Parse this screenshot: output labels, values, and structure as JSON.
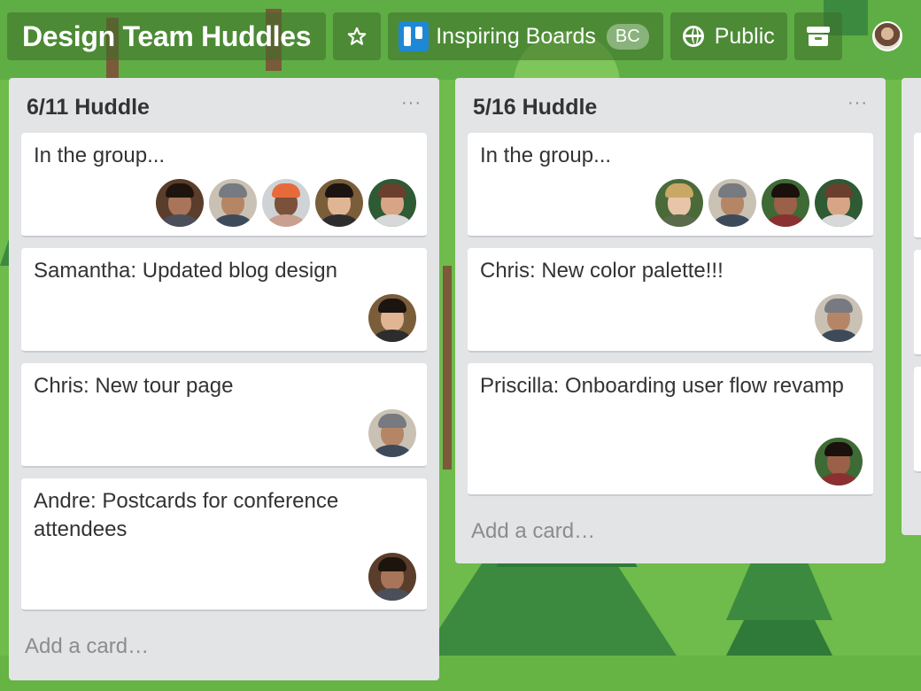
{
  "header": {
    "board_title": "Design Team Huddles",
    "team_name": "Inspiring Boards",
    "team_badge": "BC",
    "visibility": "Public"
  },
  "lists": [
    {
      "title": "6/11 Huddle",
      "menu": "···",
      "cards": [
        {
          "text": "In the group...",
          "members": [
            "andre",
            "chris",
            "cap-guy",
            "samantha",
            "bald-guy"
          ]
        },
        {
          "text": "Samantha: Updated blog design",
          "members": [
            "samantha"
          ]
        },
        {
          "text": "Chris: New tour page",
          "members": [
            "chris"
          ]
        },
        {
          "text": "Andre: Postcards for conference attendees",
          "members": [
            "andre"
          ]
        }
      ],
      "add_card": "Add a card…"
    },
    {
      "title": "5/16 Huddle",
      "menu": "···",
      "cards": [
        {
          "text": "In the group...",
          "members": [
            "blonde-woman",
            "chris",
            "priscilla",
            "bald-guy"
          ]
        },
        {
          "text": "Chris: New color palette!!!",
          "members": [
            "chris"
          ]
        },
        {
          "text": "Priscilla: Onboarding user flow revamp",
          "members": [
            "priscilla"
          ]
        }
      ],
      "add_card": "Add a card…"
    }
  ],
  "icons": {
    "star": "star-icon",
    "team": "trello-board-icon",
    "visibility": "globe-icon",
    "archive": "archive-icon"
  },
  "colors": {
    "background": "#6db84a",
    "list": "#e2e4e6",
    "card": "#ffffff",
    "team_logo": "#1e88d4"
  }
}
